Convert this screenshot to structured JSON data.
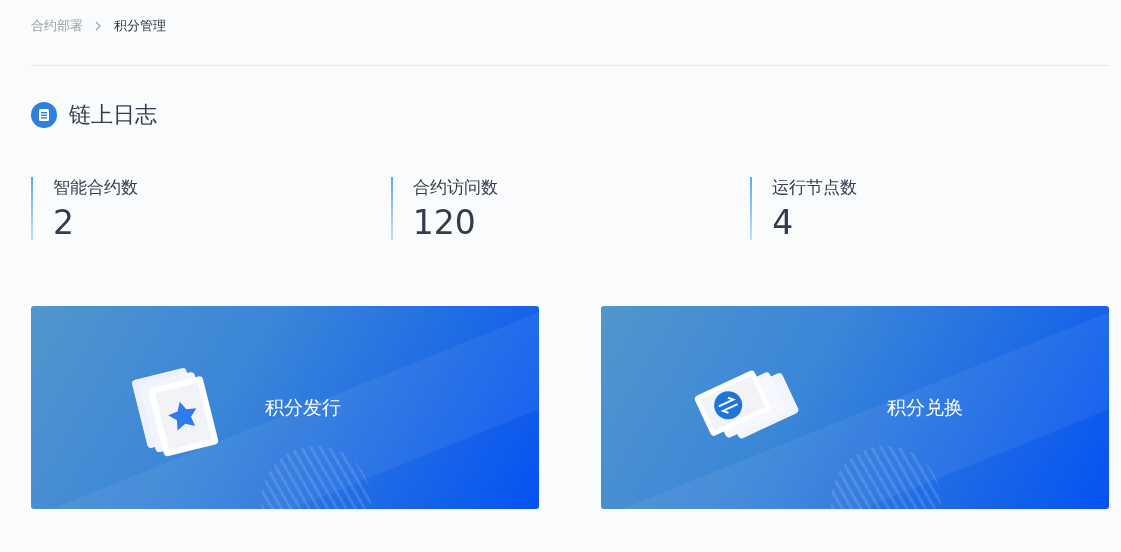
{
  "breadcrumb": [
    {
      "label": "合约部署",
      "selected": false
    },
    {
      "label": "积分管理",
      "selected": true
    }
  ],
  "section_title": "链上日志",
  "stats": [
    {
      "label": "智能合约数",
      "value": "2"
    },
    {
      "label": "合约访问数",
      "value": "120"
    },
    {
      "label": "运行节点数",
      "value": "4"
    }
  ],
  "cards": [
    {
      "kind": "issue",
      "label": "积分发行"
    },
    {
      "kind": "exchange",
      "label": "积分兑换"
    }
  ]
}
